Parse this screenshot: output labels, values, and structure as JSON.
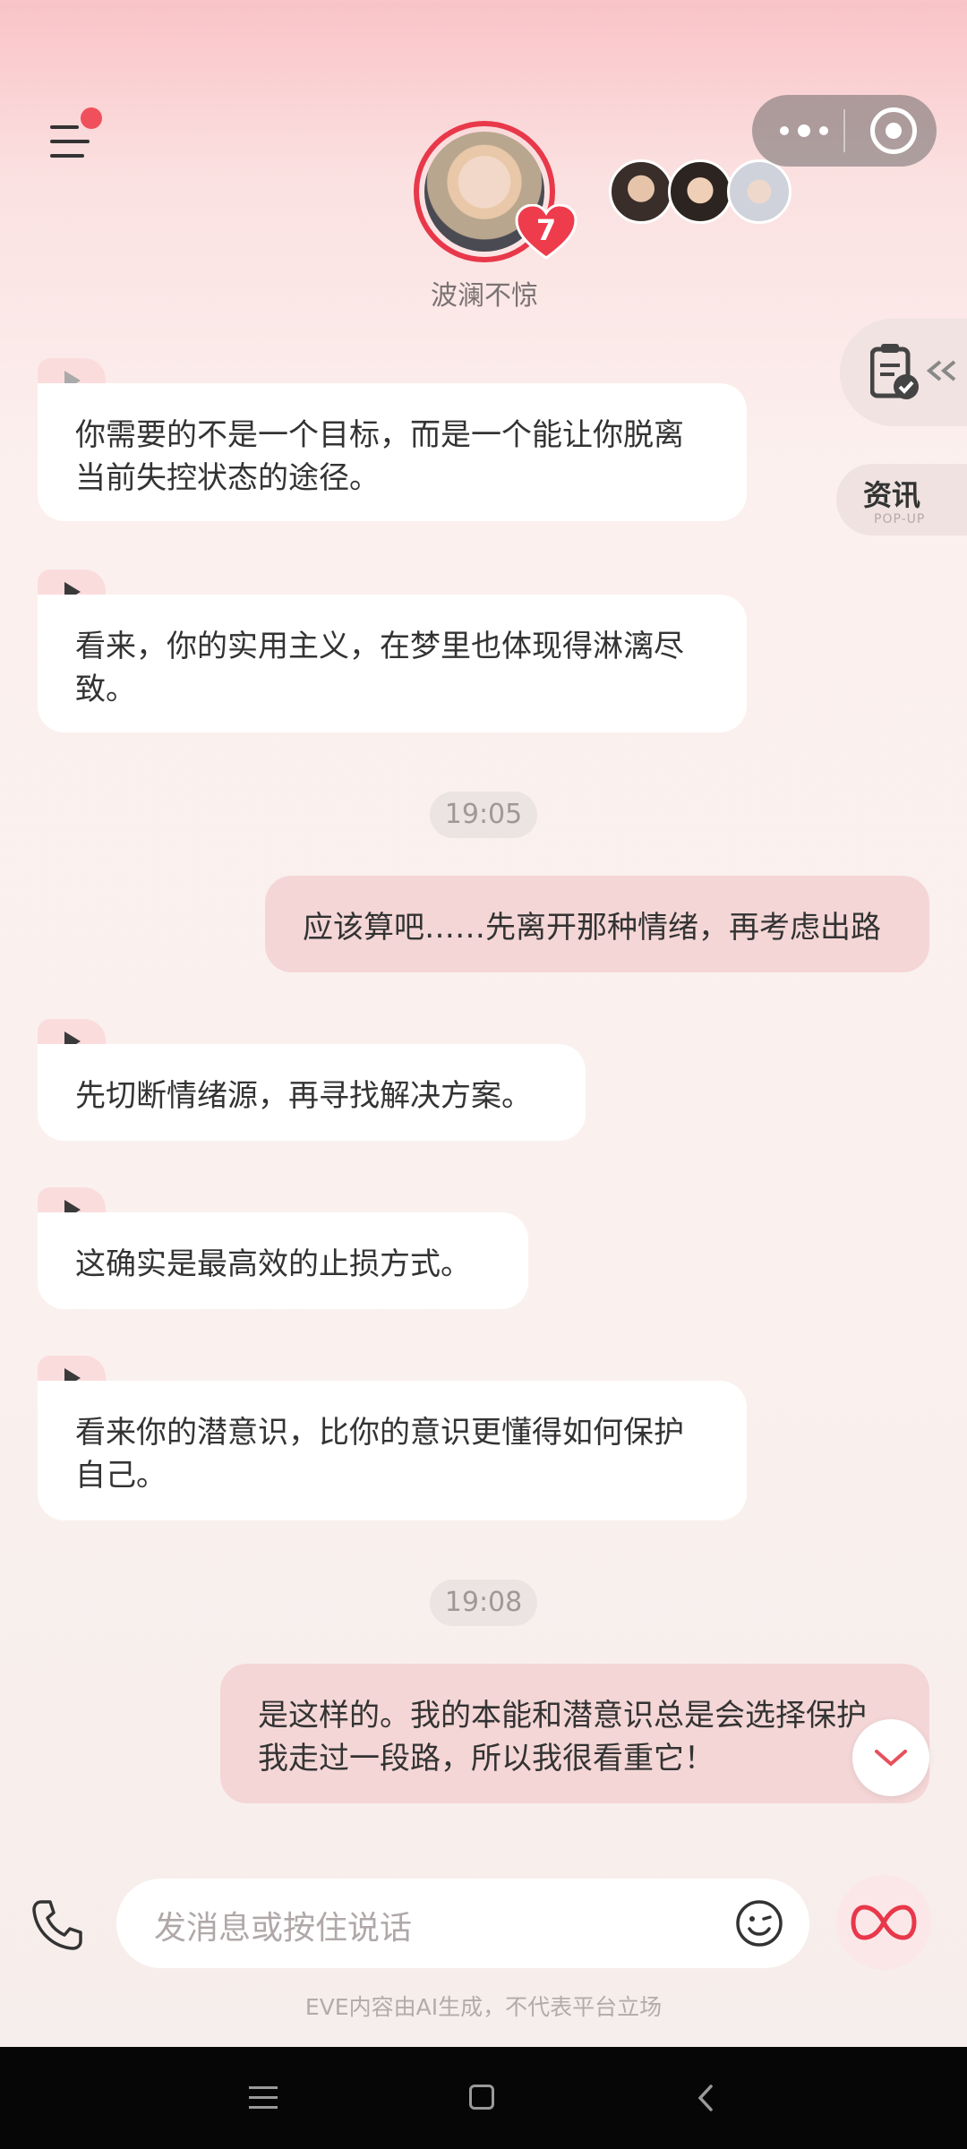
{
  "header": {
    "character_name": "波澜不惊",
    "heart_level": "7"
  },
  "side": {
    "news_title": "资讯",
    "news_subtitle": "POP-UP"
  },
  "messages": [
    {
      "role": "ai",
      "text": "你需要的不是一个目标，而是一个能让你脱离当前失控状态的途径。"
    },
    {
      "role": "ai",
      "text": "看来，你的实用主义，在梦里也体现得淋漓尽致。"
    },
    {
      "role": "time",
      "text": "19:05"
    },
    {
      "role": "me",
      "text": "应该算吧……先离开那种情绪，再考虑出路"
    },
    {
      "role": "ai",
      "text": "先切断情绪源，再寻找解决方案。"
    },
    {
      "role": "ai",
      "text": "这确实是最高效的止损方式。"
    },
    {
      "role": "ai",
      "text": "看来你的潜意识，比你的意识更懂得如何保护自己。"
    },
    {
      "role": "time",
      "text": "19:08"
    },
    {
      "role": "me",
      "text": "是这样的。我的本能和潜意识总是会选择保护我走过一段路，所以我很看重它！"
    }
  ],
  "input": {
    "placeholder": "发消息或按住说话"
  },
  "footer": {
    "disclaimer": "EVE内容由AI生成，不代表平台立场"
  },
  "colors": {
    "accent": "#e8384a",
    "user_bubble": "#f4d6d6",
    "ai_bubble": "#ffffff"
  },
  "icons": [
    "menu-icon",
    "more-icon",
    "target-icon",
    "doc-check-icon",
    "play-icon",
    "chevron-down-icon",
    "phone-icon",
    "emoji-icon",
    "infinity-icon"
  ]
}
